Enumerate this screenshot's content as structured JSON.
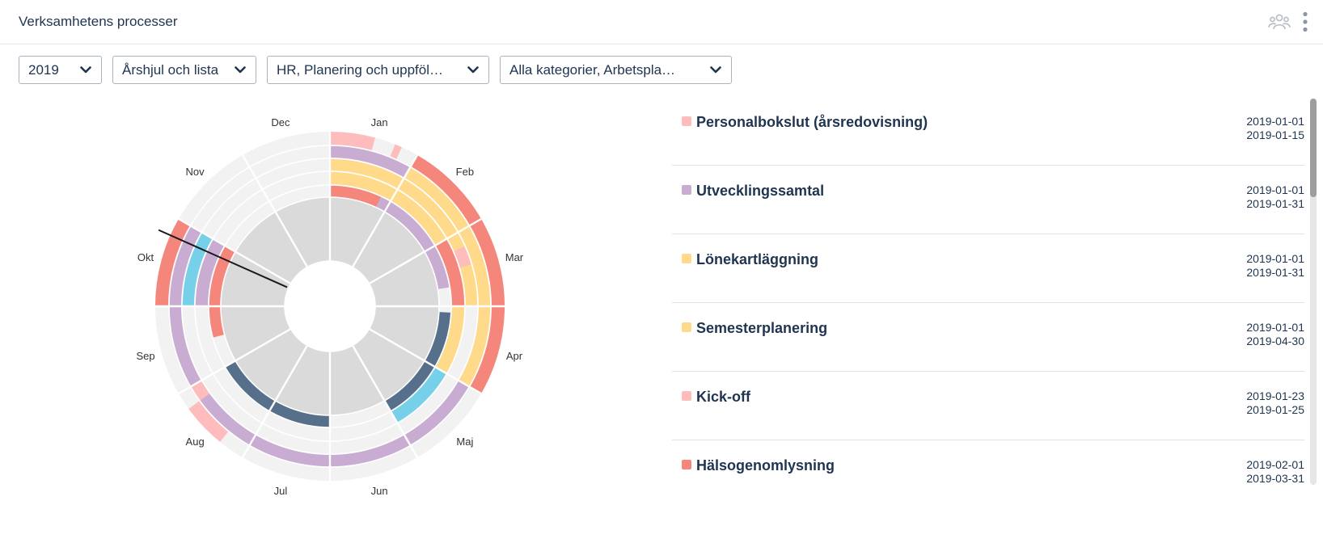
{
  "header": {
    "title": "Verksamhetens processer",
    "icons": [
      "group-icon",
      "more-vertical-icon"
    ]
  },
  "filters": [
    {
      "name": "year-select",
      "value": "2019"
    },
    {
      "name": "view-select",
      "value": "Årshjul och lista"
    },
    {
      "name": "process-select",
      "value": "HR, Planering och uppföl…"
    },
    {
      "name": "category-select",
      "value": "Alla kategorier, Arbetspla…"
    }
  ],
  "colors": {
    "pink": "#ffbcbc",
    "purple": "#c9acd1",
    "yellow": "#ffda8a",
    "red": "#f4867c",
    "cyan": "#76d0ea",
    "navy": "#56708b",
    "gray_inner": "#dadada",
    "gray_outer": "#f2f2f2"
  },
  "wheel": {
    "months": [
      "Jan",
      "Feb",
      "Mar",
      "Apr",
      "Maj",
      "Jun",
      "Jul",
      "Aug",
      "Sep",
      "Okt",
      "Nov",
      "Dec"
    ],
    "current_month_index": 9.8,
    "events": [
      {
        "ring": 1,
        "start": 0.0,
        "end": 1.0,
        "color": "red"
      },
      {
        "ring": 1,
        "start": 0.83,
        "end": 2.7,
        "color": "purple"
      },
      {
        "ring": 1,
        "start": 3.1,
        "end": 5.0,
        "color": "navy"
      },
      {
        "ring": 1,
        "start": 6.0,
        "end": 8.0,
        "color": "navy"
      },
      {
        "ring": 1,
        "start": 8.5,
        "end": 10.0,
        "color": "red"
      },
      {
        "ring": 2,
        "start": 3.0,
        "end": 5.0,
        "color": "cyan"
      },
      {
        "ring": 2,
        "start": 0.0,
        "end": 4.0,
        "color": "yellow"
      },
      {
        "ring": 2,
        "start": 2.0,
        "end": 3.0,
        "color": "red"
      },
      {
        "ring": 2,
        "start": 9.0,
        "end": 10.0,
        "color": "purple"
      },
      {
        "ring": 3,
        "start": 0.0,
        "end": 3.0,
        "color": "yellow"
      },
      {
        "ring": 3,
        "start": 2.2,
        "end": 2.45,
        "color": "pink"
      },
      {
        "ring": 3,
        "start": 9.0,
        "end": 10.0,
        "color": "cyan"
      },
      {
        "ring": 4,
        "start": 0.0,
        "end": 1.0,
        "color": "purple"
      },
      {
        "ring": 4,
        "start": 1.0,
        "end": 4.0,
        "color": "yellow"
      },
      {
        "ring": 4,
        "start": 4.0,
        "end": 9.0,
        "color": "purple"
      },
      {
        "ring": 4,
        "start": 7.8,
        "end": 8.0,
        "color": "pink"
      },
      {
        "ring": 4,
        "start": 9.0,
        "end": 10.0,
        "color": "purple"
      },
      {
        "ring": 5,
        "start": 0.0,
        "end": 0.5,
        "color": "pink"
      },
      {
        "ring": 5,
        "start": 0.73,
        "end": 0.81,
        "color": "pink"
      },
      {
        "ring": 5,
        "start": 1.0,
        "end": 4.0,
        "color": "red"
      },
      {
        "ring": 5,
        "start": 7.3,
        "end": 7.8,
        "color": "pink"
      },
      {
        "ring": 5,
        "start": 9.0,
        "end": 10.0,
        "color": "red"
      }
    ]
  },
  "list": [
    {
      "title": "Personalbokslut (årsredovisning)",
      "start": "2019-01-01",
      "end": "2019-01-15",
      "color": "pink"
    },
    {
      "title": "Utvecklingssamtal",
      "start": "2019-01-01",
      "end": "2019-01-31",
      "color": "purple"
    },
    {
      "title": "Lönekartläggning",
      "start": "2019-01-01",
      "end": "2019-01-31",
      "color": "yellow"
    },
    {
      "title": "Semesterplanering",
      "start": "2019-01-01",
      "end": "2019-04-30",
      "color": "yellow"
    },
    {
      "title": "Kick-off",
      "start": "2019-01-23",
      "end": "2019-01-25",
      "color": "pink"
    },
    {
      "title": "Hälsogenomlysning",
      "start": "2019-02-01",
      "end": "2019-03-31",
      "color": "red"
    }
  ]
}
